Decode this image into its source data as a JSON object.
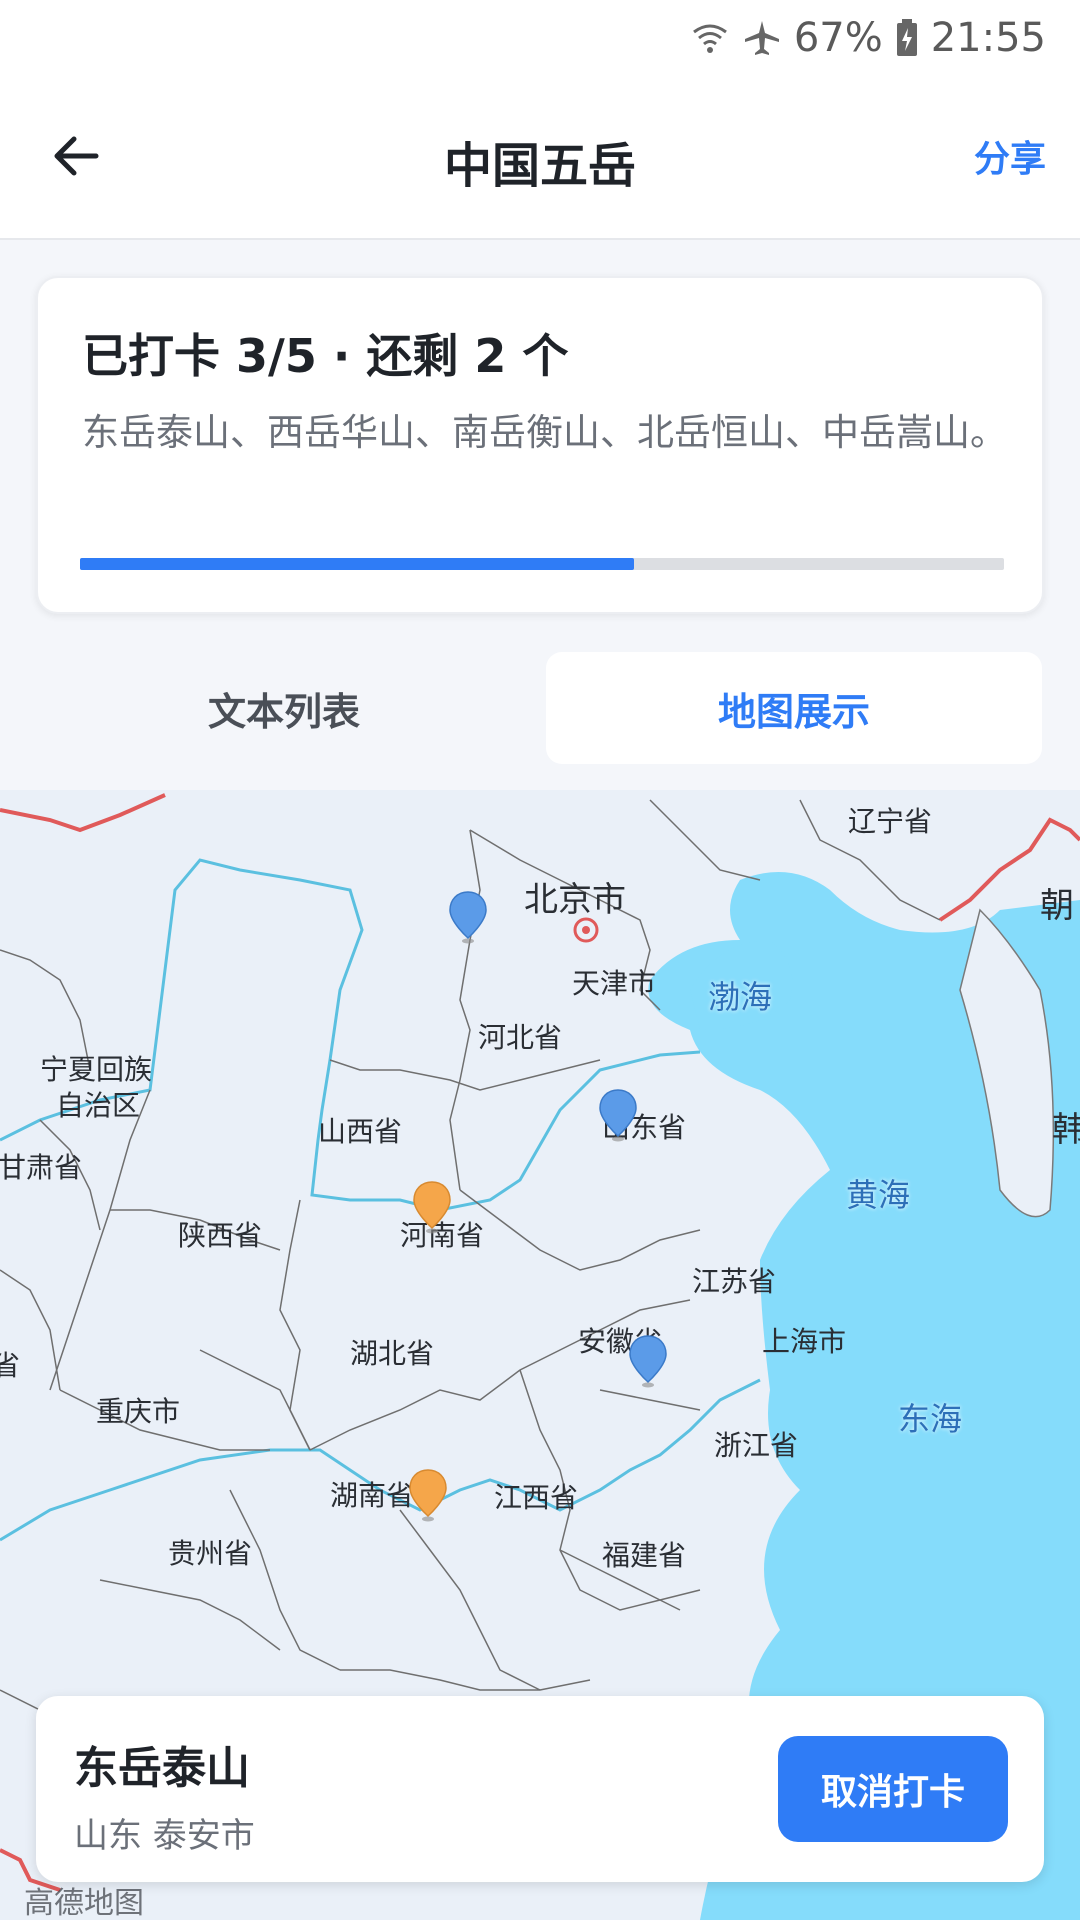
{
  "status_bar": {
    "battery": "67%",
    "time": "21:55"
  },
  "header": {
    "title": "中国五岳",
    "share": "分享"
  },
  "progress": {
    "title": "已打卡 3/5 · 还剩 2 个",
    "description": "东岳泰山、西岳华山、南岳衡山、北岳恒山、中岳嵩山。",
    "fraction": 0.6
  },
  "tabs": [
    {
      "label": "文本列表",
      "selected": false
    },
    {
      "label": "地图展示",
      "selected": true
    }
  ],
  "map": {
    "labels": {
      "liaoning": "辽宁省",
      "beijing": "北京市",
      "chao": "朝",
      "tianjin": "天津市",
      "bohai": "渤海",
      "hebei": "河北省",
      "ningxia1": "宁夏回族",
      "ningxia2": "自治区",
      "han": "韩",
      "shanxi": "山西省",
      "shandong": "山东省",
      "gansu": "甘肃省",
      "huanghai": "黄海",
      "shaanxi": "陕西省",
      "henan": "河南省",
      "jiangsu": "江苏省",
      "anhui": "安徽省",
      "shanghai": "上海市",
      "sheng": "省",
      "hubei": "湖北省",
      "chongqing": "重庆市",
      "donghai": "东海",
      "zhejiang": "浙江省",
      "hunan": "湖南省",
      "jiangxi": "江西省",
      "guizhou": "贵州省",
      "fujian": "福建省"
    },
    "logo": "高德地图"
  },
  "selected_place": {
    "name": "东岳泰山",
    "location": "山东 泰安市",
    "action": "取消打卡"
  },
  "colors": {
    "accent": "#2f7cf6",
    "pin_checked": "#f5a64a",
    "pin_unchecked": "#5b9be8",
    "sea": "#85dcfb",
    "land": "#eaf0f8",
    "border_red": "#e05a5a",
    "river": "#5bc0e0"
  }
}
